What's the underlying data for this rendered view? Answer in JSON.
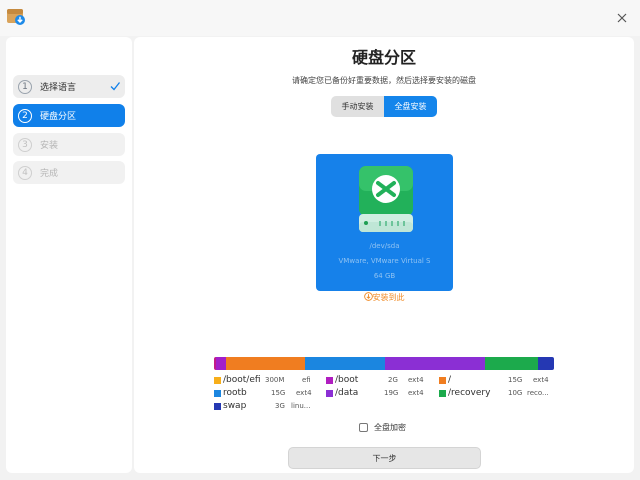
{
  "sidebar": {
    "steps": [
      {
        "num": "1",
        "label": "选择语言"
      },
      {
        "num": "2",
        "label": "硬盘分区"
      },
      {
        "num": "3",
        "label": "安装"
      },
      {
        "num": "4",
        "label": "完成"
      }
    ]
  },
  "main": {
    "title": "硬盘分区",
    "subtitle": "请确定您已备份好重要数据，然后选择要安装的磁盘",
    "tabs": {
      "manual": "手动安装",
      "full": "全盘安装",
      "selected": "全盘安装"
    },
    "disk": {
      "device": "/dev/sda",
      "model": "VMware, VMware Virtual S",
      "size": "64 GB",
      "install_here": "安装到此"
    },
    "partitions": [
      {
        "name": "/boot/efi",
        "size": "300M",
        "fs": "efi",
        "color": "#c21a8a",
        "share": 0.005
      },
      {
        "name": "/boot",
        "size": "2G",
        "fs": "ext4",
        "color": "#a21fc9",
        "share": 0.031
      },
      {
        "name": "/",
        "size": "15G",
        "fs": "ext4",
        "color": "#f07d20",
        "share": 0.234
      },
      {
        "name": "rootb",
        "size": "15G",
        "fs": "ext4",
        "color": "#1b86e0",
        "share": 0.234
      },
      {
        "name": "/data",
        "size": "19G",
        "fs": "ext4",
        "color": "#8b2fd4",
        "share": 0.297
      },
      {
        "name": "/recovery",
        "size": "10G",
        "fs": "reco...",
        "color": "#1caa4c",
        "share": 0.156
      },
      {
        "name": "swap",
        "size": "3G",
        "fs": "linu...",
        "color": "#2538b3",
        "share": 0.047
      }
    ],
    "legend_swatch_colors": [
      "#f7ae1a",
      "#b01ec0",
      "#f07d20",
      "#1b86e0",
      "#8b2fd4",
      "#1caa4c",
      "#2538b3"
    ],
    "encrypt_label": "全盘加密",
    "next_label": "下一步"
  },
  "colors": {
    "accent": "#1080ea",
    "warning": "#f08a24"
  }
}
